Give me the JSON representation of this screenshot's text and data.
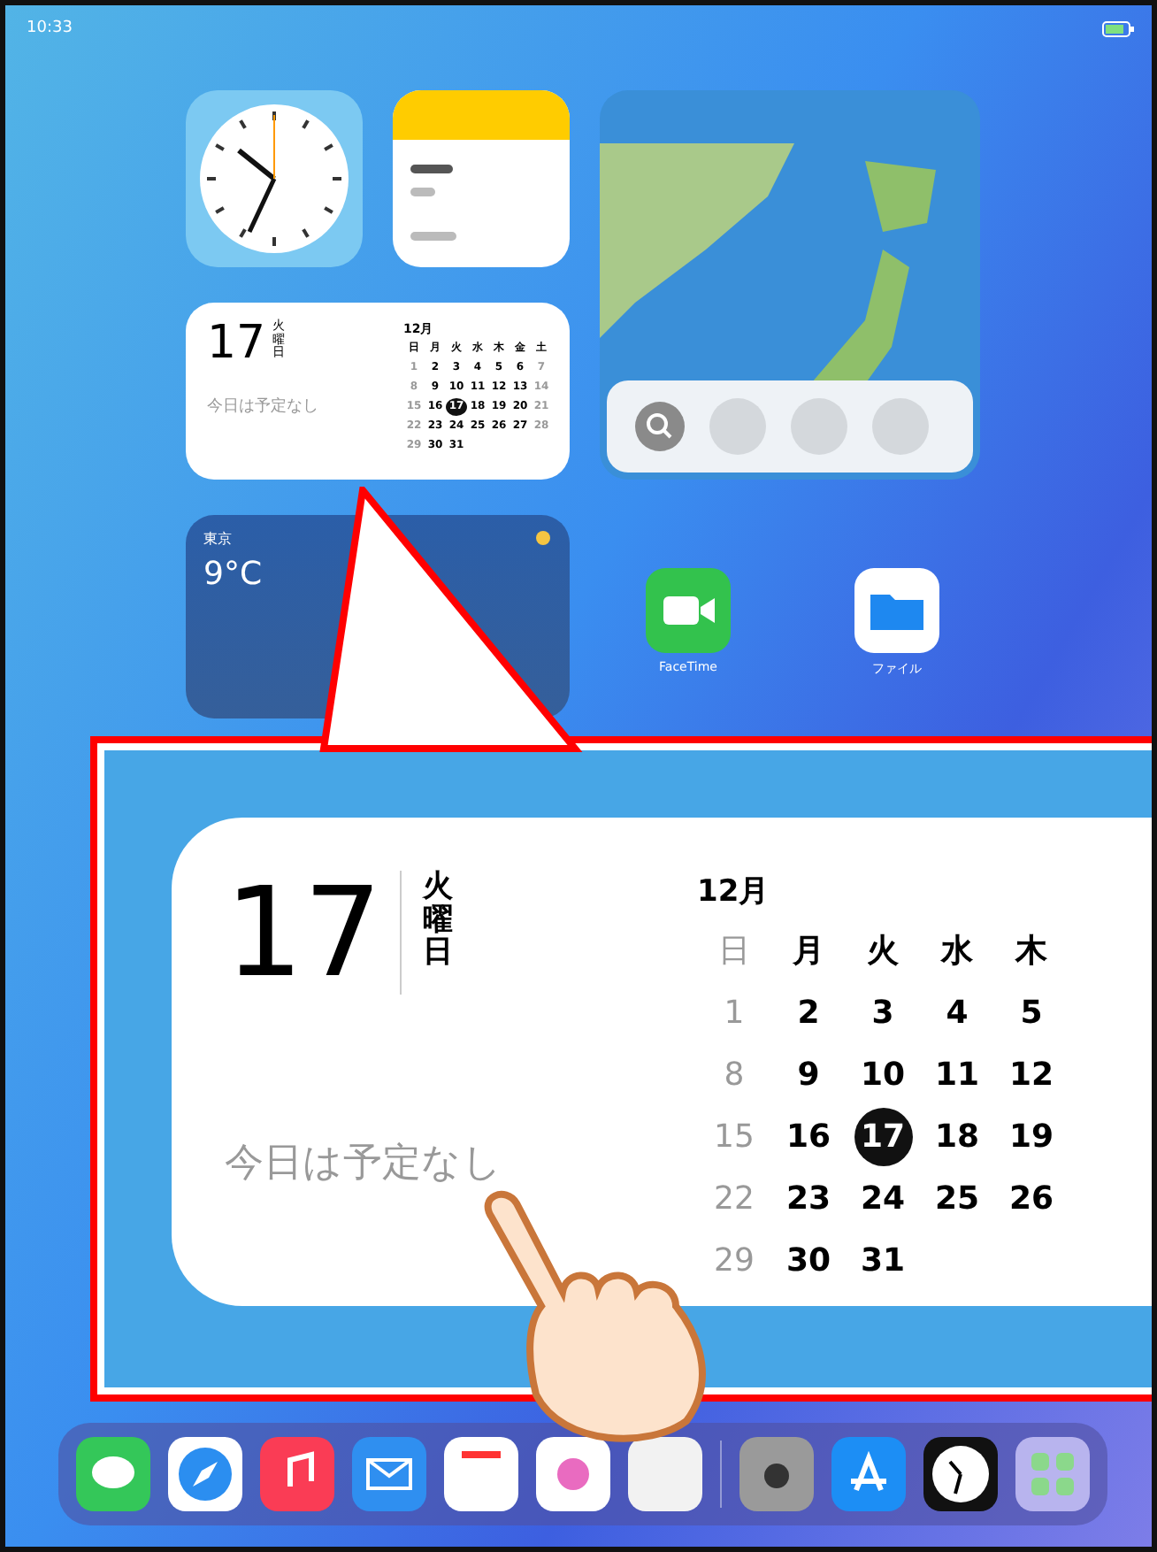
{
  "status_bar": {
    "time": "10:33"
  },
  "mini_calendar": {
    "day": "17",
    "weekday": "火曜日",
    "no_events": "今日は予定なし",
    "month": "12月",
    "weekdays": [
      "日",
      "月",
      "火",
      "水",
      "木",
      "金",
      "土"
    ],
    "weeks": [
      [
        {
          "text": "1",
          "selected": false
        },
        {
          "text": "2",
          "selected": false
        },
        {
          "text": "3",
          "selected": false
        },
        {
          "text": "4",
          "selected": false
        },
        {
          "text": "5",
          "selected": false
        },
        {
          "text": "6",
          "selected": false
        },
        {
          "text": "7",
          "selected": false
        }
      ],
      [
        {
          "text": "8",
          "selected": false
        },
        {
          "text": "9",
          "selected": false
        },
        {
          "text": "10",
          "selected": false
        },
        {
          "text": "11",
          "selected": false
        },
        {
          "text": "12",
          "selected": false
        },
        {
          "text": "13",
          "selected": false
        },
        {
          "text": "14",
          "selected": false
        }
      ],
      [
        {
          "text": "15",
          "selected": false
        },
        {
          "text": "16",
          "selected": false
        },
        {
          "text": "17",
          "selected": true
        },
        {
          "text": "18",
          "selected": false
        },
        {
          "text": "19",
          "selected": false
        },
        {
          "text": "20",
          "selected": false
        },
        {
          "text": "21",
          "selected": false
        }
      ],
      [
        {
          "text": "22",
          "selected": false
        },
        {
          "text": "23",
          "selected": false
        },
        {
          "text": "24",
          "selected": false
        },
        {
          "text": "25",
          "selected": false
        },
        {
          "text": "26",
          "selected": false
        },
        {
          "text": "27",
          "selected": false
        },
        {
          "text": "28",
          "selected": false
        }
      ],
      [
        {
          "text": "29",
          "selected": false
        },
        {
          "text": "30",
          "selected": false
        },
        {
          "text": "31",
          "selected": false
        }
      ]
    ]
  },
  "weather": {
    "city": "東京",
    "temperature": "9°C"
  },
  "apps": [
    {
      "label": "FaceTime",
      "kind": "facetime"
    },
    {
      "label": "ファイル",
      "kind": "files"
    }
  ],
  "callout": {
    "day": "17",
    "weekday": "火曜日",
    "no_events": "今日は予定なし",
    "month": "12月",
    "weekdays": [
      "日",
      "月",
      "火",
      "水",
      "木"
    ],
    "weeks": [
      [
        {
          "text": "1",
          "selected": false
        },
        {
          "text": "2",
          "selected": false
        },
        {
          "text": "3",
          "selected": false
        },
        {
          "text": "4",
          "selected": false
        },
        {
          "text": "5",
          "selected": false
        }
      ],
      [
        {
          "text": "8",
          "selected": false
        },
        {
          "text": "9",
          "selected": false
        },
        {
          "text": "10",
          "selected": false
        },
        {
          "text": "11",
          "selected": false
        },
        {
          "text": "12",
          "selected": false
        }
      ],
      [
        {
          "text": "15",
          "selected": false
        },
        {
          "text": "16",
          "selected": false
        },
        {
          "text": "17",
          "selected": true
        },
        {
          "text": "18",
          "selected": false
        },
        {
          "text": "19",
          "selected": false
        }
      ],
      [
        {
          "text": "22",
          "selected": false
        },
        {
          "text": "23",
          "selected": false
        },
        {
          "text": "24",
          "selected": false
        },
        {
          "text": "25",
          "selected": false
        },
        {
          "text": "26",
          "selected": false
        }
      ],
      [
        {
          "text": "29",
          "selected": false
        },
        {
          "text": "30",
          "selected": false
        },
        {
          "text": "31",
          "selected": false
        }
      ]
    ]
  },
  "dock": [
    {
      "kind": "messages"
    },
    {
      "kind": "safari"
    },
    {
      "kind": "music"
    },
    {
      "kind": "mail"
    },
    {
      "kind": "calendar"
    },
    {
      "kind": "photos"
    },
    {
      "kind": "blank"
    },
    {
      "kind": "camera"
    },
    {
      "kind": "appstore"
    },
    {
      "kind": "clock"
    },
    {
      "kind": "library"
    }
  ]
}
